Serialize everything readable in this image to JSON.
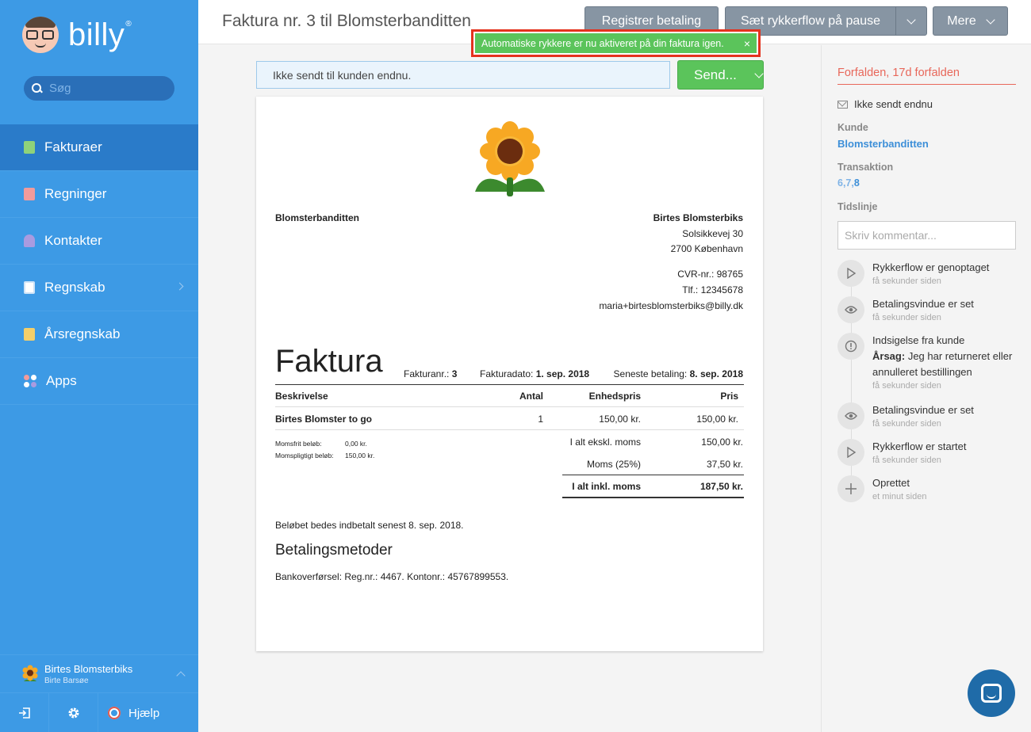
{
  "app": {
    "logo_text": "billy",
    "logo_reg": "®"
  },
  "search": {
    "placeholder": "Søg"
  },
  "nav": {
    "items": [
      {
        "label": "Fakturaer"
      },
      {
        "label": "Regninger"
      },
      {
        "label": "Kontakter"
      },
      {
        "label": "Regnskab"
      },
      {
        "label": "Årsregnskab"
      },
      {
        "label": "Apps"
      }
    ]
  },
  "org": {
    "name": "Birtes Blomsterbiks",
    "user": "Birte Barsøe"
  },
  "bottom": {
    "help": "Hjælp"
  },
  "header": {
    "title": "Faktura nr. 3 til Blomsterbanditten",
    "register_payment": "Registrer betaling",
    "pause_flow": "Sæt rykkerflow på pause",
    "more": "Mere"
  },
  "toast": {
    "message": "Automatiske rykkere er nu aktiveret på din faktura igen.",
    "close": "×"
  },
  "status_bar": {
    "text": "Ikke sendt til kunden endnu."
  },
  "send_button": {
    "label": "Send..."
  },
  "invoice": {
    "customer": "Blomsterbanditten",
    "sender_name": "Birtes Blomsterbiks",
    "sender_street": "Solsikkevej 30",
    "sender_city": "2700 København",
    "cvr": "CVR-nr.: 98765",
    "phone": "Tlf.: 12345678",
    "email": "maria+birtesblomsterbiks@billy.dk",
    "title": "Faktura",
    "invoice_no_label": "Fakturanr.:",
    "invoice_no": "3",
    "invoice_date_label": "Fakturadato:",
    "invoice_date": "1. sep. 2018",
    "due_label": "Seneste betaling:",
    "due_date": "8. sep. 2018",
    "columns": {
      "desc": "Beskrivelse",
      "qty": "Antal",
      "unit": "Enhedspris",
      "price": "Pris"
    },
    "lines": [
      {
        "desc": "Birtes Blomster to go",
        "qty": "1",
        "unit": "150,00 kr.",
        "price": "150,00 kr."
      }
    ],
    "tax_free_label": "Momsfrit beløb:",
    "tax_free_value": "0,00 kr.",
    "taxable_label": "Momspligtigt beløb:",
    "taxable_value": "150,00 kr.",
    "subtotal_label": "I alt ekskl. moms",
    "subtotal": "150,00 kr.",
    "vat_label": "Moms (25%)",
    "vat": "37,50 kr.",
    "total_label": "I alt inkl. moms",
    "total": "187,50 kr.",
    "pay_note": "Beløbet bedes indbetalt senest 8. sep. 2018.",
    "methods_title": "Betalingsmetoder",
    "bank": "Bankoverførsel: Reg.nr.: 4467. Kontonr.: 45767899553."
  },
  "panel": {
    "due_status": "Forfalden, 17d forfalden",
    "not_sent": "Ikke sendt endnu",
    "customer_label": "Kunde",
    "customer": "Blomsterbanditten",
    "transaction_label": "Transaktion",
    "transaction_plain": "6,7,",
    "transaction_link": "8",
    "timeline_label": "Tidslinje",
    "comment_placeholder": "Skriv kommentar...",
    "timeline": [
      {
        "title": "Rykkerflow er genoptaget",
        "time": "få sekunder siden",
        "icon": "play-icon"
      },
      {
        "title": "Betalingsvindue er set",
        "time": "få sekunder siden",
        "icon": "eye-icon"
      },
      {
        "title": "Indsigelse fra kunde",
        "reason_label": "Årsag:",
        "reason": "Jeg har returneret eller annulleret bestillingen",
        "time": "få sekunder siden",
        "icon": "alert-icon"
      },
      {
        "title": "Betalingsvindue er set",
        "time": "få sekunder siden",
        "icon": "eye-icon"
      },
      {
        "title": "Rykkerflow er startet",
        "time": "få sekunder siden",
        "icon": "play-icon"
      },
      {
        "title": "Oprettet",
        "time": "et minut siden",
        "icon": "plus-icon"
      }
    ]
  },
  "colors": {
    "sidebar": "#3d9ae5",
    "active": "#2a7bc9",
    "success": "#5bc45b",
    "danger": "#e8675a",
    "button": "#8795a3",
    "highlight": "#e4321e"
  }
}
